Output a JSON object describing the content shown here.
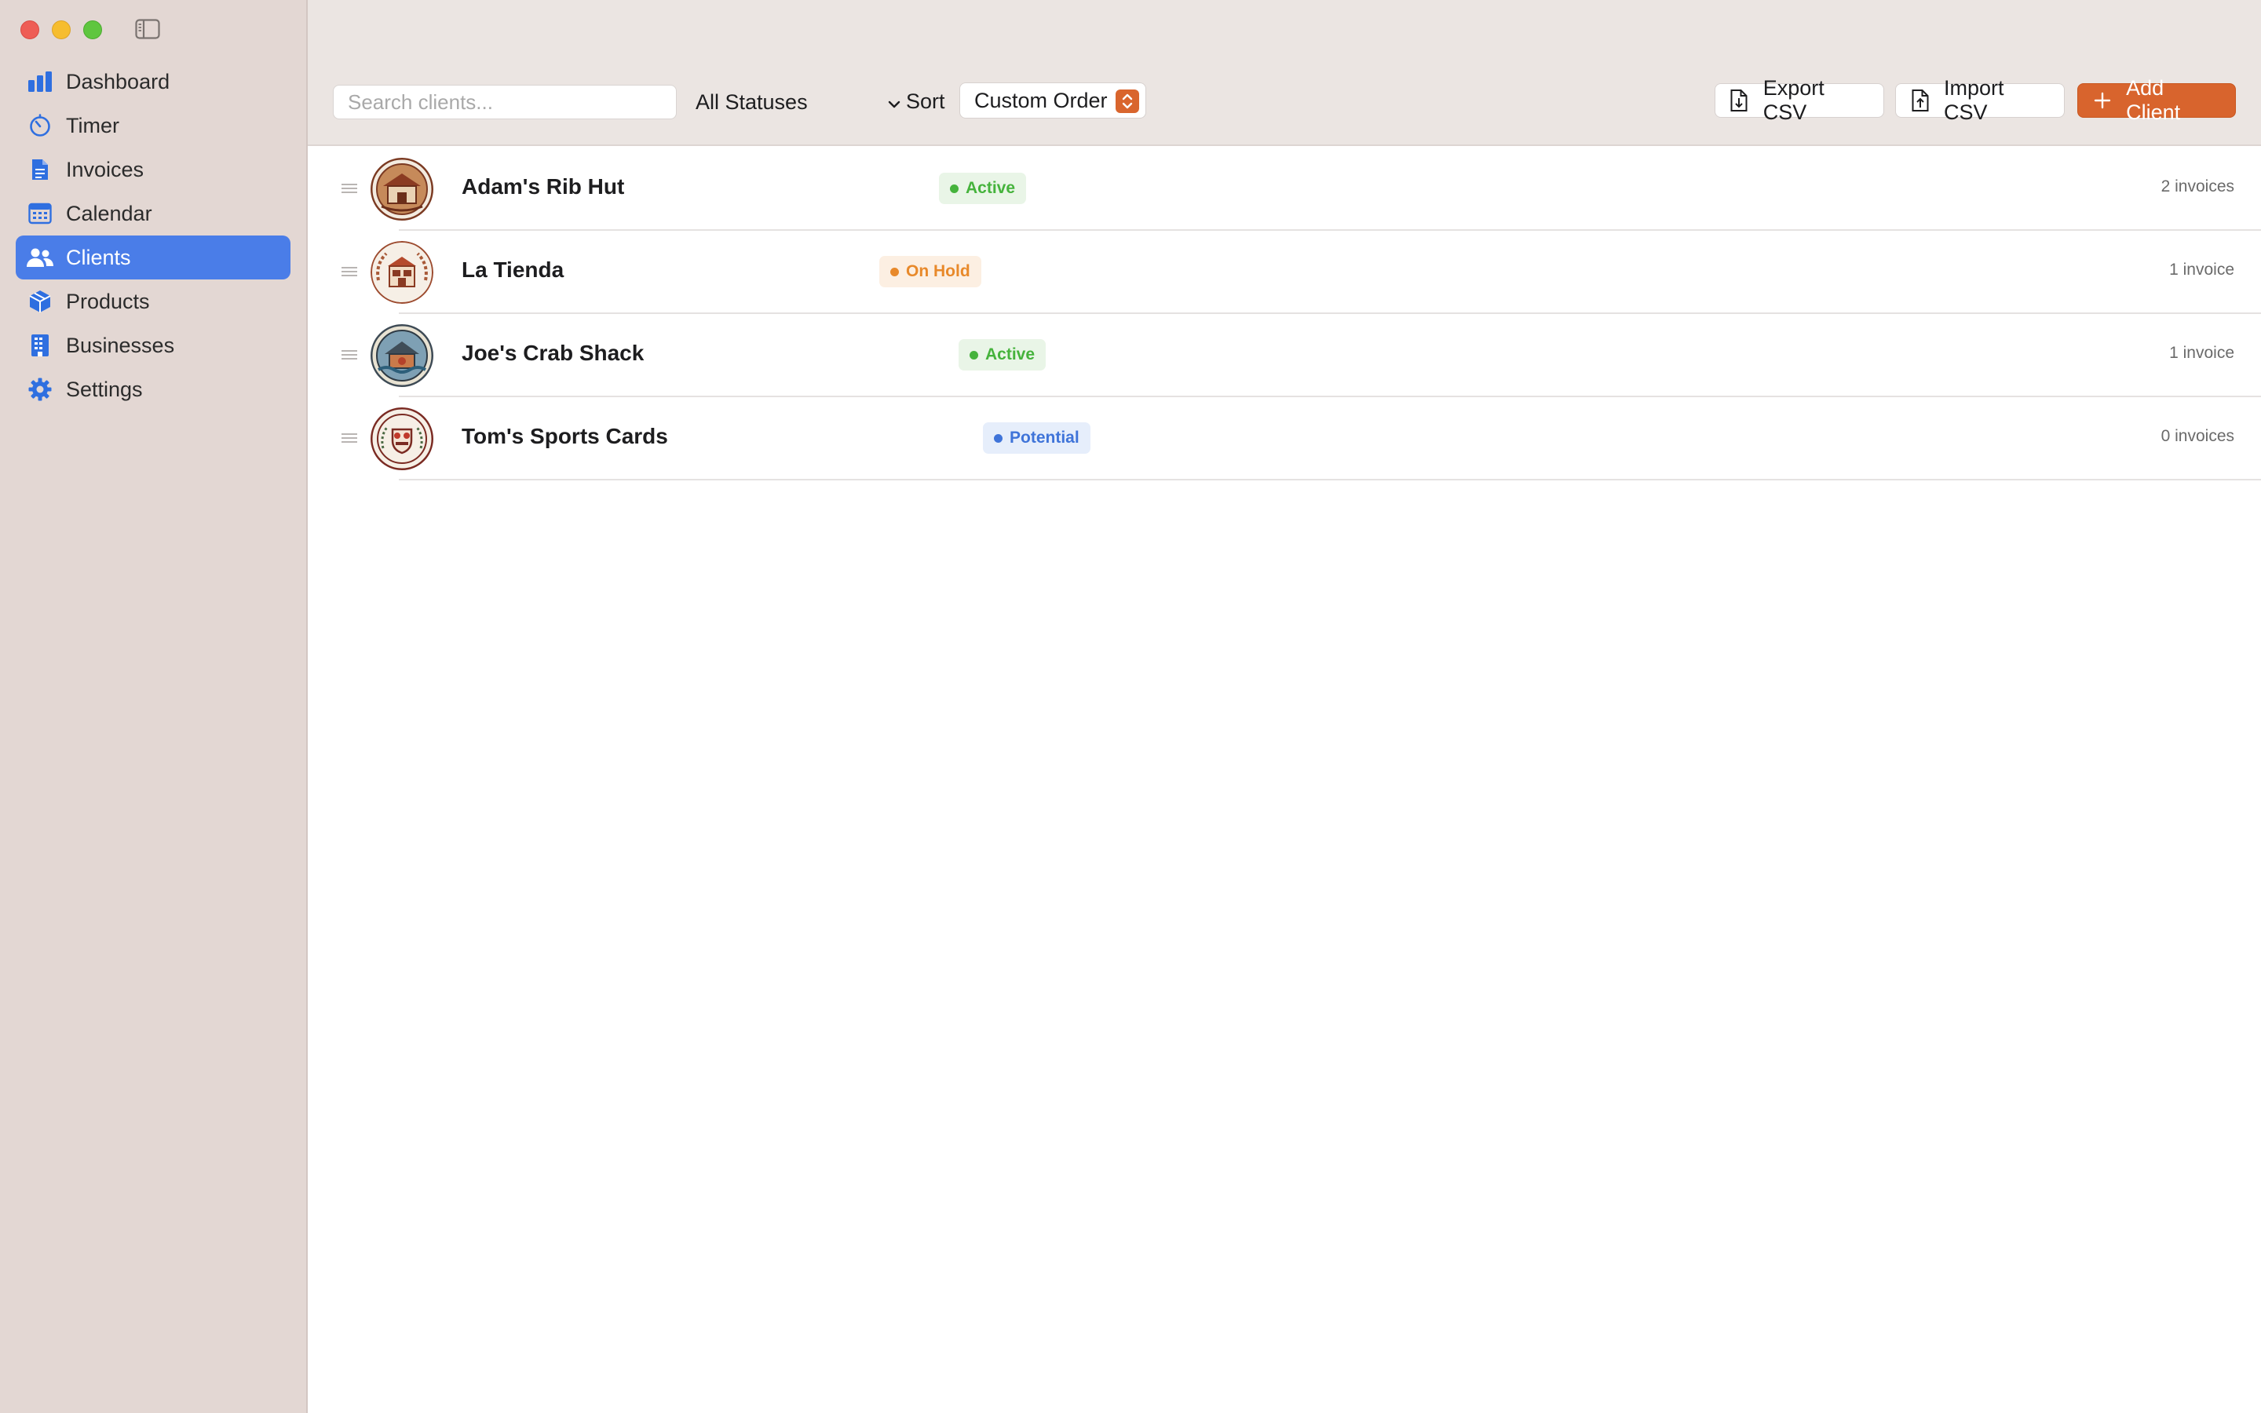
{
  "window": {
    "controls": [
      "close",
      "minimize",
      "zoom"
    ],
    "sidebar_toggle_icon": "sidebar-toggle-icon"
  },
  "sidebar": {
    "items": [
      {
        "label": "Dashboard",
        "icon": "chart-bar-icon",
        "active": false
      },
      {
        "label": "Timer",
        "icon": "timer-icon",
        "active": false
      },
      {
        "label": "Invoices",
        "icon": "document-icon",
        "active": false
      },
      {
        "label": "Calendar",
        "icon": "calendar-icon",
        "active": false
      },
      {
        "label": "Clients",
        "icon": "people-icon",
        "active": true
      },
      {
        "label": "Products",
        "icon": "box-icon",
        "active": false
      },
      {
        "label": "Businesses",
        "icon": "building-icon",
        "active": false
      },
      {
        "label": "Settings",
        "icon": "gear-icon",
        "active": false
      }
    ]
  },
  "toolbar": {
    "search_placeholder": "Search clients...",
    "status_filter": "All Statuses",
    "sort_label": "Sort",
    "sort_value": "Custom Order",
    "export_label": "Export CSV",
    "import_label": "Import CSV",
    "add_label": "Add Client"
  },
  "clients": [
    {
      "name": "Adam's Rib Hut",
      "status": "Active",
      "invoices": "2 invoices"
    },
    {
      "name": "La Tienda",
      "status": "On Hold",
      "invoices": "1 invoice"
    },
    {
      "name": "Joe's Crab Shack",
      "status": "Active",
      "invoices": "1 invoice"
    },
    {
      "name": "Tom's Sports Cards",
      "status": "Potential",
      "invoices": "0 invoices"
    }
  ],
  "colors": {
    "sidebar_bg": "#e3d7d3",
    "toolbar_bg": "#ebe5e2",
    "selection": "#4a7de8",
    "accent": "#d8642d",
    "status_active": "#45b33c",
    "status_on_hold": "#e8892a",
    "status_potential": "#3f74d9"
  }
}
